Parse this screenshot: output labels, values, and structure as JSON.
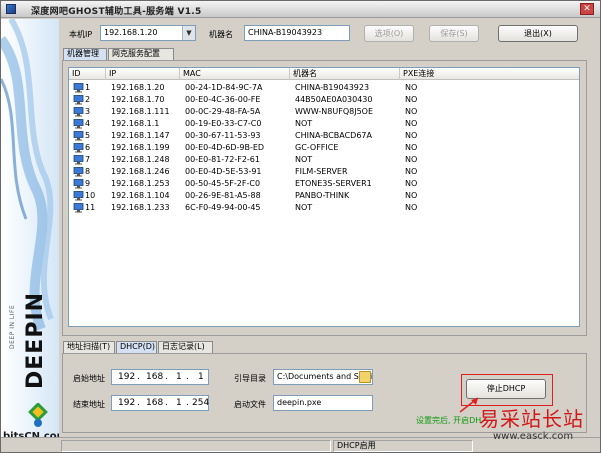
{
  "window": {
    "title": "深度网吧GHOST辅助工具-服务端   V1.5"
  },
  "branding": {
    "small_text": "DEEP IN LIFE",
    "big_text": "DEEPIN",
    "site_logo": "bitsCN.com"
  },
  "header": {
    "local_ip_label": "本机IP",
    "local_ip_value": "192.168.1.20",
    "machine_name_label": "机器名",
    "machine_name_value": "CHINA-B19043923",
    "options_button": "选项(O)",
    "save_button": "保存(S)",
    "exit_button": "退出(X)"
  },
  "top_tabs": [
    {
      "label": "机器管理",
      "active": true
    },
    {
      "label": "网克服务配置",
      "active": false
    }
  ],
  "machine_table": {
    "columns": [
      "ID",
      "IP",
      "MAC",
      "机器名",
      "PXE连接"
    ],
    "rows": [
      {
        "id": "1",
        "ip": "192.168.1.20",
        "mac": "00-24-1D-84-9C-7A",
        "name": "CHINA-B19043923",
        "pxe": "NO"
      },
      {
        "id": "2",
        "ip": "192.168.1.70",
        "mac": "00-E0-4C-36-00-FE",
        "name": "44B50AE0A030430",
        "pxe": "NO"
      },
      {
        "id": "3",
        "ip": "192.168.1.111",
        "mac": "00-0C-29-48-FA-5A",
        "name": "WWW-N8UFQ8J5OE",
        "pxe": "NO"
      },
      {
        "id": "4",
        "ip": "192.168.1.1",
        "mac": "00-19-E0-33-C7-C0",
        "name": "NOT",
        "pxe": "NO"
      },
      {
        "id": "5",
        "ip": "192.168.1.147",
        "mac": "00-30-67-11-53-93",
        "name": "CHINA-BCBACD67A",
        "pxe": "NO"
      },
      {
        "id": "6",
        "ip": "192.168.1.199",
        "mac": "00-E0-4D-6D-9B-ED",
        "name": "GC-OFFICE",
        "pxe": "NO"
      },
      {
        "id": "7",
        "ip": "192.168.1.248",
        "mac": "00-E0-81-72-F2-61",
        "name": "NOT",
        "pxe": "NO"
      },
      {
        "id": "8",
        "ip": "192.168.1.246",
        "mac": "00-E0-4D-5E-53-91",
        "name": "FILM-SERVER",
        "pxe": "NO"
      },
      {
        "id": "9",
        "ip": "192.168.1.253",
        "mac": "00-50-45-5F-2F-C0",
        "name": "ETONE3S-SERVER1",
        "pxe": "NO"
      },
      {
        "id": "10",
        "ip": "192.168.1.104",
        "mac": "00-26-9E-81-A5-88",
        "name": "PANBO-THINK",
        "pxe": "NO"
      },
      {
        "id": "11",
        "ip": "192.168.1.233",
        "mac": "6C-F0-49-94-00-45",
        "name": "NOT",
        "pxe": "NO"
      }
    ]
  },
  "bottom_tabs": [
    {
      "label": "地址扫描(T)",
      "active": false
    },
    {
      "label": "DHCP(D)",
      "active": true
    },
    {
      "label": "日志记录(L)",
      "active": false
    }
  ],
  "dhcp": {
    "start_label": "启始地址",
    "start_ip": [
      "192",
      "168",
      "1",
      "1"
    ],
    "end_label": "结束地址",
    "end_ip": [
      "192",
      "168",
      "1",
      "254"
    ],
    "boot_dir_label": "引导目录",
    "boot_dir_value": "C:\\Documents and Setti",
    "boot_file_label": "启动文件",
    "boot_file_value": "deepin.pxe",
    "stop_button": "停止DHCP"
  },
  "annotation": {
    "text": "设置完后, 开启DH"
  },
  "status_bar": {
    "pane1": "",
    "pane2": "DHCP启用"
  },
  "watermark": {
    "line1": "易采站长站",
    "line2": "www.easck.com"
  },
  "colors": {
    "accent_tab": "#d4e1f2",
    "annotation_red": "#e02020",
    "annotation_green": "#119911"
  }
}
